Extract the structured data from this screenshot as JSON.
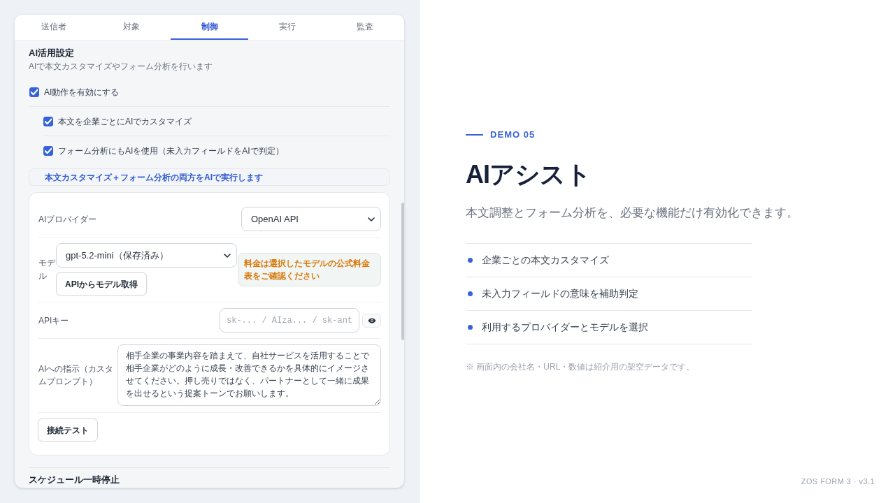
{
  "tabs": [
    {
      "label": "送信者",
      "selected": false
    },
    {
      "label": "対象",
      "selected": false
    },
    {
      "label": "制御",
      "selected": true
    },
    {
      "label": "実行",
      "selected": false
    },
    {
      "label": "監査",
      "selected": false
    }
  ],
  "section": {
    "title": "AI活用設定",
    "description": "AIで本文カスタマイズやフォーム分析を行います"
  },
  "toggles": [
    {
      "label": "AI動作を有効にする",
      "checked": true,
      "children": [
        {
          "label": "本文を企業ごとにAIでカスタマイズ",
          "checked": true
        },
        {
          "label": "フォーム分析にもAIを使用（未入力フィールドをAIで判定）",
          "checked": true
        }
      ]
    }
  ],
  "mode_note": "本文カスタマイズ＋フォーム分析の両方をAIで実行します",
  "settings": {
    "provider": {
      "label": "AIプロバイダー",
      "value": "OpenAI API"
    },
    "model": {
      "label": "モデル",
      "value": "gpt-5.2-mini（保存済み）",
      "fetch_button": "APIからモデル取得",
      "notice": "料金は選択したモデルの公式料金表をご確認ください"
    },
    "api_key": {
      "label": "APIキー",
      "placeholder": "sk-... / AIza... / sk-ant"
    },
    "prompt": {
      "label": "AIへの指示（カスタムプロンプト）",
      "value": "相手企業の事業内容を踏まえて、自社サービスを活用することで相手企業がどのように成長・改善できるかを具体的にイメージさせてください。押し売りではなく、パートナーとして一緒に成果を出せるという提案トーンでお願いします。"
    },
    "test_button": "接続テスト"
  },
  "next_section": {
    "title": "スケジュール一時停止"
  },
  "hero": {
    "eyebrow": "DEMO 05",
    "title": "AIアシスト",
    "lead": "本文調整とフォーム分析を、必要な機能だけ有効化できます。",
    "features": [
      "企業ごとの本文カスタマイズ",
      "未入力フィールドの意味を補助判定",
      "利用するプロバイダーとモデルを選択"
    ],
    "note": "※ 画面内の会社名・URL・数値は紹介用の架空データです。"
  },
  "footer": "ZOS FORM 3 · v3.1"
}
